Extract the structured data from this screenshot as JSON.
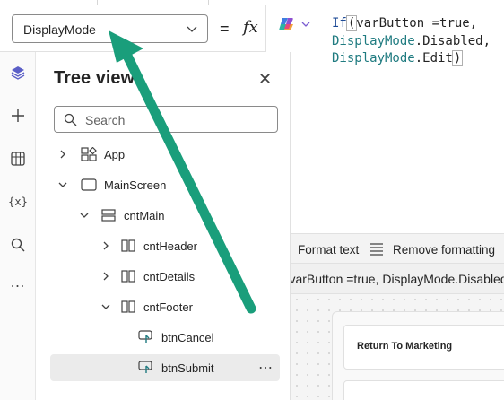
{
  "formula_bar": {
    "property": "DisplayMode",
    "equals": "=",
    "fx": "fx"
  },
  "formula": {
    "line1_fn": "If",
    "line1_rest": "varButton =true,",
    "line2_ident": "DisplayMode",
    "line2_rest": ".Disabled,",
    "line3_ident": "DisplayMode",
    "line3_rest": ".Edit"
  },
  "formula_toolbar": {
    "format_text": "Format text",
    "remove_formatting": "Remove formatting"
  },
  "formula_preview": "If(varButton =true, DisplayMode.Disabled",
  "rail": {
    "icons": [
      "layers-icon",
      "add-icon",
      "table-icon",
      "variables-icon",
      "search-icon",
      "more-icon"
    ],
    "variables_label": "{x}"
  },
  "tree_view": {
    "title": "Tree view",
    "search_placeholder": "Search",
    "items": [
      {
        "label": "App"
      },
      {
        "label": "MainScreen"
      },
      {
        "label": "cntMain"
      },
      {
        "label": "cntHeader"
      },
      {
        "label": "cntDetails"
      },
      {
        "label": "cntFooter"
      },
      {
        "label": "btnCancel"
      },
      {
        "label": "btnSubmit"
      }
    ]
  },
  "canvas": {
    "button_text": "Return To Marketing"
  },
  "colors": {
    "arrow": "#1a9e7b",
    "code_function": "#1d4a96",
    "code_identifier": "#1f7b80"
  }
}
